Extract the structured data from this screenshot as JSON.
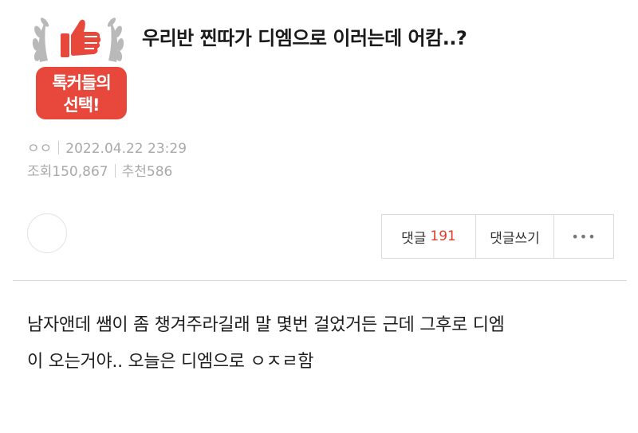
{
  "badge": {
    "line1": "톡커들의",
    "line2": "선택!",
    "icon": "thumbs-up-icon",
    "colors": {
      "red": "#E8483C",
      "wreath": "#B9B9B9"
    }
  },
  "post": {
    "title": "우리반 찐따가 디엠으로 이러는데 어캄..?",
    "author": "ㅇㅇ",
    "date": "2022.04.22 23:29",
    "views_label": "조회",
    "views": "150,867",
    "recommend_label": "추천",
    "recommend": "586",
    "body_line1": "남자앤데 쌤이 좀 챙겨주라길래 말 몇번 걸었거든 근데 그후로 디엠",
    "body_line2": "이 오는거야.. 오늘은 디엠으로 ㅇㅈㄹ함"
  },
  "actions": {
    "comments_label": "댓글",
    "comments_count": "191",
    "write_label": "댓글쓰기",
    "more_label": "•••"
  },
  "colors": {
    "accent": "#E03E2D",
    "meta": "#A9A9A9"
  }
}
